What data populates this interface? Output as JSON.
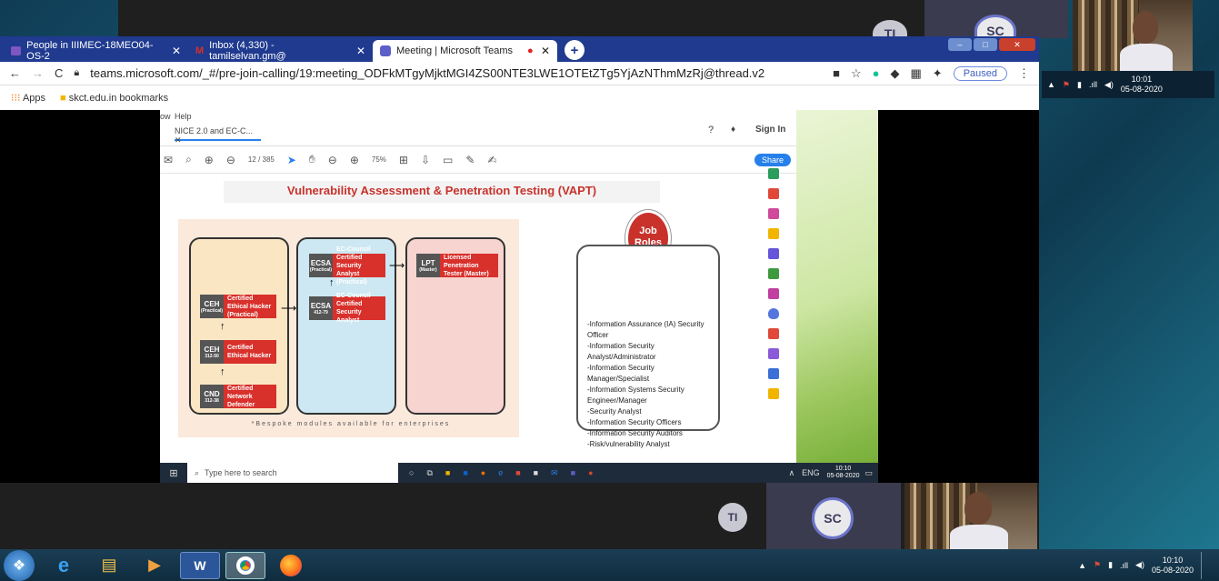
{
  "browser": {
    "tabs": [
      {
        "label": "People in IIIMEC-18MEO04-OS-2",
        "icon": "google-classroom-icon",
        "color": "#7e57c2"
      },
      {
        "label": "Inbox (4,330) - tamilselvan.gm@",
        "icon": "gmail-icon",
        "color": "#d93025"
      },
      {
        "label": "Meeting | Microsoft Teams",
        "icon": "teams-icon",
        "color": "#5b5fc7"
      }
    ],
    "url": "teams.microsoft.com/_#/pre-join-calling/19:meeting_ODFkMTgyMjktMGI4ZS00NTE3LWE1OTEtZTg5YjAzNThmMzRj@thread.v2",
    "paused_label": "Paused",
    "bookmarks": [
      "Apps",
      "skct.edu.in bookmarks"
    ]
  },
  "pdf": {
    "menu_help": "Help",
    "menu_prev": "ow",
    "tab_label": "NICE 2.0 and EC-C...",
    "sign_in": "Sign In",
    "page_current": "12",
    "page_total": "/ 385",
    "zoom": "75%",
    "share_label": "Share"
  },
  "slide": {
    "title": "Vulnerability Assessment & Penetration Testing (VAPT)",
    "certs": [
      {
        "code": "CEH",
        "sub": "(Practical)",
        "name": "Certified Ethical Hacker (Practical)"
      },
      {
        "code": "CEH",
        "sub": "312-50",
        "name": "Certified Ethical Hacker"
      },
      {
        "code": "CND",
        "sub": "312-38",
        "name": "Certified Network Defender"
      },
      {
        "code": "ECSA",
        "sub": "(Practical)",
        "name": "EC-Council Certified Security Analyst (Practical)"
      },
      {
        "code": "ECSA",
        "sub": "412-79",
        "name": "EC-Council Certified Security Analyst"
      },
      {
        "code": "LPT",
        "sub": "(Master)",
        "name": "Licensed Penetration Tester (Master)"
      }
    ],
    "footnote": "*Bespoke modules available for enterprises",
    "job_roles_title": "Job Roles",
    "job_roles": [
      "-Information Assurance (IA) Security Officer",
      "-Information Security Analyst/Administrator",
      "-Information Security Manager/Specialist",
      "-Information Systems Security Engineer/Manager",
      "-Security Analyst",
      "-Information Security Officers",
      "-Information Security Auditors",
      "-Risk/vulnerability Analyst"
    ]
  },
  "inner_taskbar": {
    "search_placeholder": "Type here to search",
    "lang": "ENG",
    "time": "10:10",
    "date": "05-08-2020"
  },
  "remote_tray": {
    "time": "10:01",
    "date": "05-08-2020"
  },
  "participants": {
    "ti": "TI",
    "sc": "SC"
  },
  "taskbar": {
    "time": "10:10",
    "date": "05-08-2020",
    "apps": [
      "start-orb-icon",
      "internet-explorer-icon",
      "file-explorer-icon",
      "media-player-icon",
      "word-icon",
      "chrome-icon",
      "firefox-icon"
    ]
  }
}
